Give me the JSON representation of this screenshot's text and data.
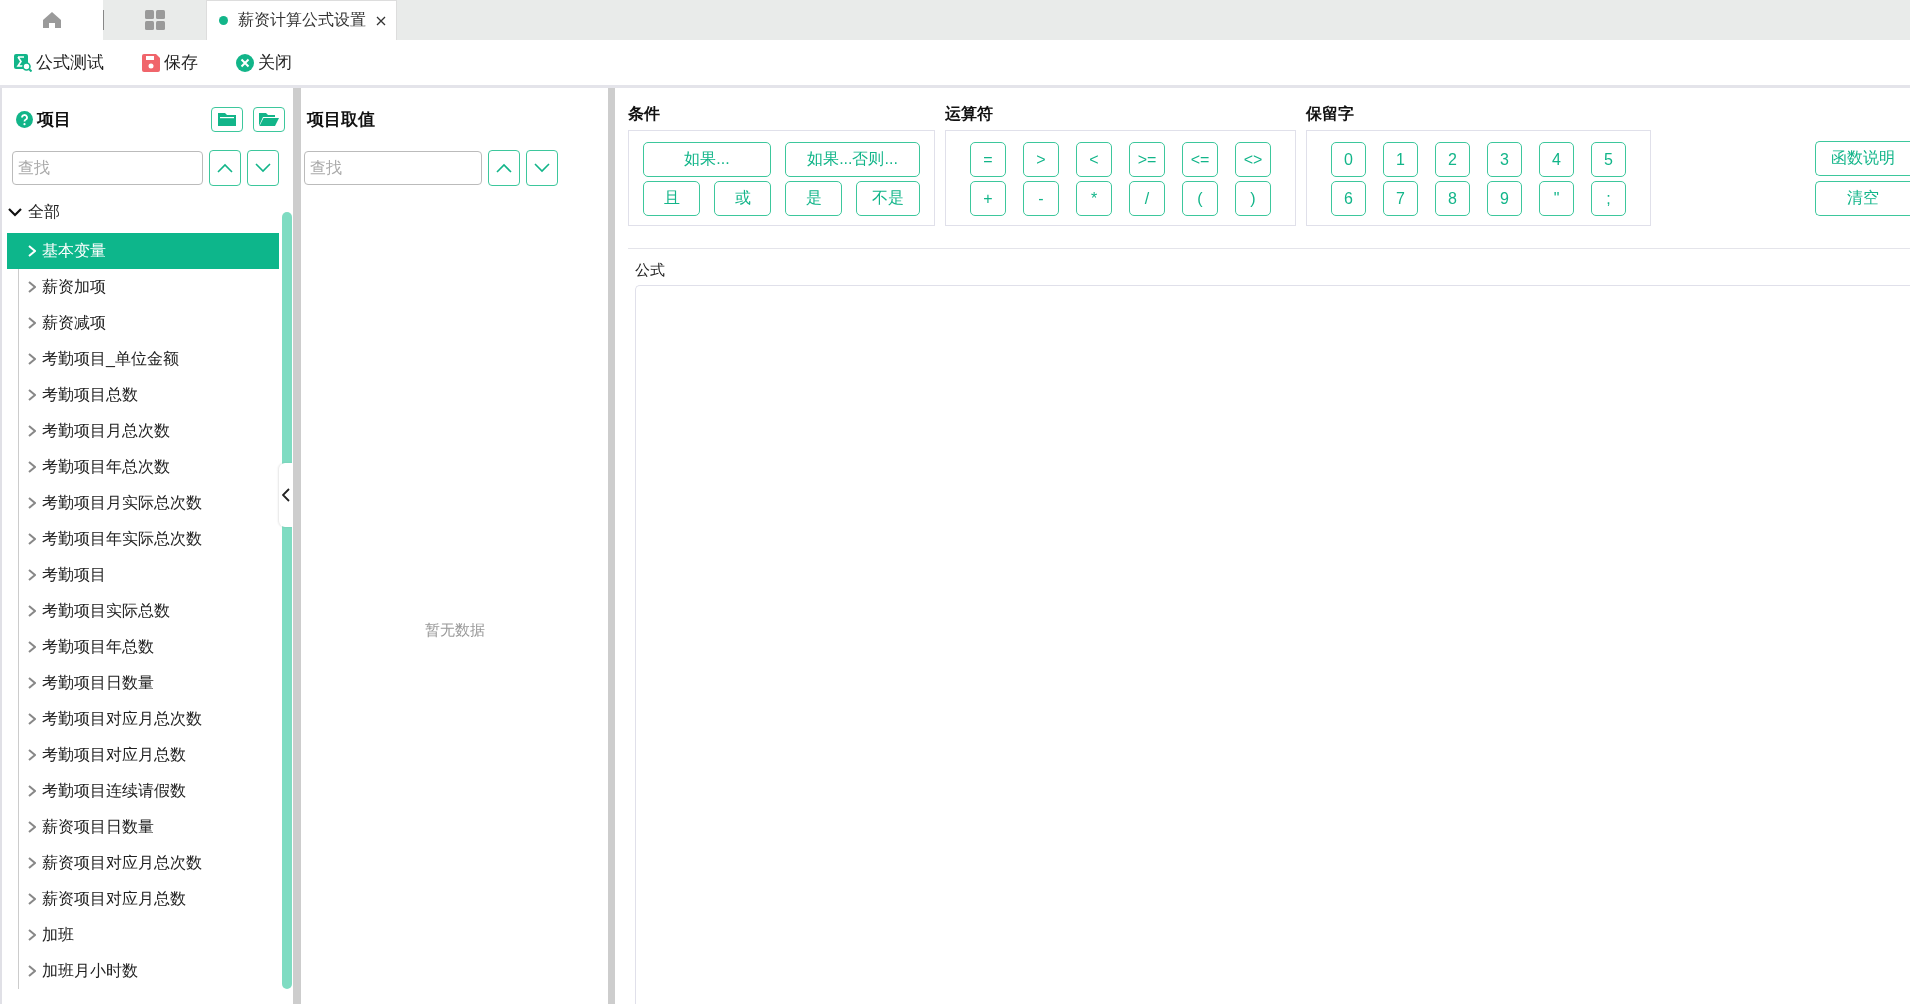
{
  "tabs": [
    {
      "label": "薪资计算公式设置",
      "selected": true
    }
  ],
  "toolbar": [
    {
      "kind": "test",
      "label": "公式测试"
    },
    {
      "kind": "save",
      "label": "保存"
    },
    {
      "kind": "close",
      "label": "关闭"
    }
  ],
  "items_panel": {
    "title": "项目",
    "search": {
      "placeholder": "查找"
    },
    "tree": {
      "label": "全部",
      "expanded": true,
      "children": [
        {
          "label": "基本变量",
          "selected": true,
          "expanded": false
        },
        {
          "label": "薪资加项",
          "selected": false,
          "expanded": false
        },
        {
          "label": "薪资减项",
          "selected": false,
          "expanded": false
        },
        {
          "label": "考勤项目_单位金额",
          "selected": false,
          "expanded": false
        },
        {
          "label": "考勤项目总数",
          "selected": false,
          "expanded": false
        },
        {
          "label": "考勤项目月总次数",
          "selected": false,
          "expanded": false
        },
        {
          "label": "考勤项目年总次数",
          "selected": false,
          "expanded": false
        },
        {
          "label": "考勤项目月实际总次数",
          "selected": false,
          "expanded": false
        },
        {
          "label": "考勤项目年实际总次数",
          "selected": false,
          "expanded": false
        },
        {
          "label": "考勤项目",
          "selected": false,
          "expanded": false
        },
        {
          "label": "考勤项目实际总数",
          "selected": false,
          "expanded": false
        },
        {
          "label": "考勤项目年总数",
          "selected": false,
          "expanded": false
        },
        {
          "label": "考勤项目日数量",
          "selected": false,
          "expanded": false
        },
        {
          "label": "考勤项目对应月总次数",
          "selected": false,
          "expanded": false
        },
        {
          "label": "考勤项目对应月总数",
          "selected": false,
          "expanded": false
        },
        {
          "label": "考勤项目连续请假数",
          "selected": false,
          "expanded": false
        },
        {
          "label": "薪资项目日数量",
          "selected": false,
          "expanded": false
        },
        {
          "label": "薪资项目对应月总次数",
          "selected": false,
          "expanded": false
        },
        {
          "label": "薪资项目对应月总数",
          "selected": false,
          "expanded": false
        },
        {
          "label": "加班",
          "selected": false,
          "expanded": false
        },
        {
          "label": "加班月小时数",
          "selected": false,
          "expanded": false
        }
      ]
    }
  },
  "values_panel": {
    "title": "项目取值",
    "search": {
      "placeholder": "查找"
    },
    "empty_text": "暂无数据"
  },
  "conditions": {
    "title": "条件",
    "buttons": [
      "如果...",
      "如果...否则...",
      "且",
      "或",
      "是",
      "不是"
    ]
  },
  "operators": {
    "title": "运算符",
    "rows": [
      [
        "=",
        ">",
        "<",
        ">=",
        "<=",
        "<>"
      ],
      [
        "+",
        "-",
        "*",
        "/",
        "(",
        ")"
      ]
    ]
  },
  "reserved_words": {
    "title": "保留字",
    "rows": [
      [
        "0",
        "1",
        "2",
        "3",
        "4",
        "5"
      ],
      [
        "6",
        "7",
        "8",
        "9",
        "\"",
        ";"
      ]
    ]
  },
  "side_buttons": [
    "函数说明",
    "清空"
  ],
  "formula": {
    "label": "公式"
  }
}
